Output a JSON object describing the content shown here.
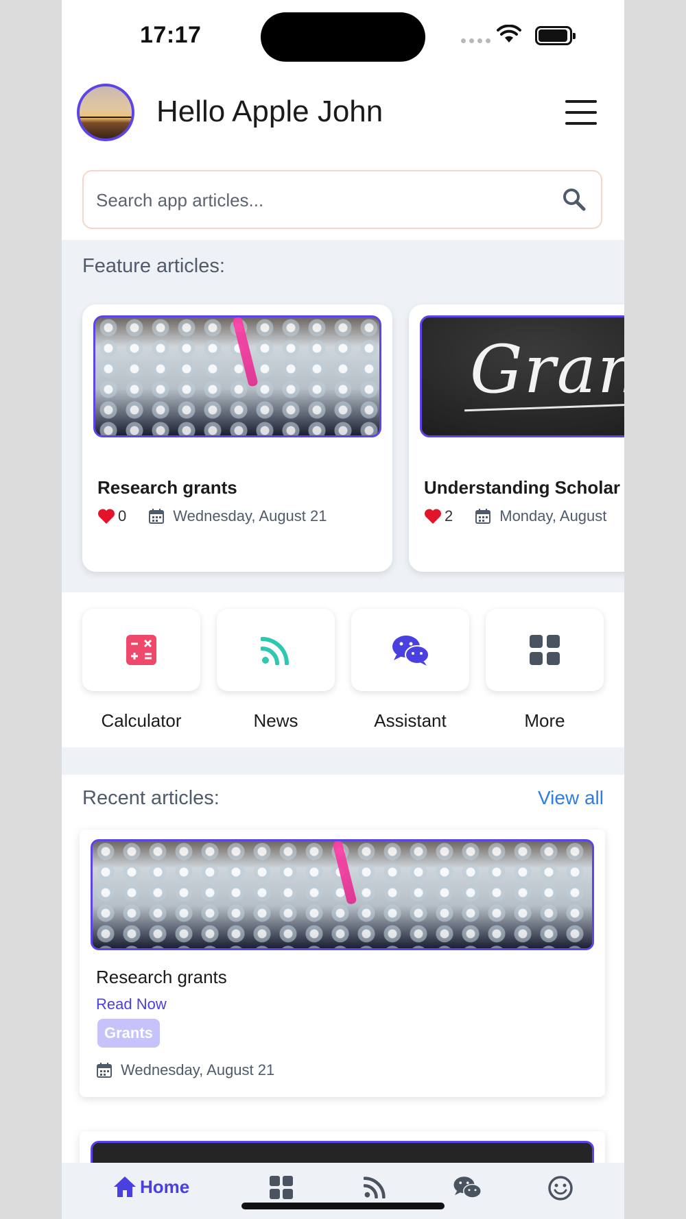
{
  "status_bar": {
    "time": "17:17"
  },
  "header": {
    "greeting": "Hello Apple John",
    "search": {
      "placeholder": "Search app articles..."
    }
  },
  "feature_section": {
    "title": "Feature articles:",
    "cards": [
      {
        "title": "Research grants",
        "likes": "0",
        "date": "Wednesday, August 21",
        "image": "lab-tubes"
      },
      {
        "title": "Understanding Scholar",
        "likes": "2",
        "date": "Monday, August",
        "image": "grant-chalkboard",
        "image_text": "Gran"
      }
    ]
  },
  "quick_actions": [
    {
      "label": "Calculator",
      "icon": "calculator-icon",
      "color": "#f0486b"
    },
    {
      "label": "News",
      "icon": "rss-icon",
      "color": "#2ec7b0"
    },
    {
      "label": "Assistant",
      "icon": "chat-icon",
      "color": "#4a3fe0"
    },
    {
      "label": "More",
      "icon": "grid-icon",
      "color": "#4a5360"
    }
  ],
  "recent_section": {
    "title": "Recent articles:",
    "view_all": "View all",
    "cards": [
      {
        "title": "Research grants",
        "cta": "Read Now",
        "tag": "Grants",
        "date": "Wednesday, August 21",
        "image": "lab-tubes"
      }
    ]
  },
  "bottom_nav": {
    "items": [
      {
        "label": "Home",
        "icon": "home-icon",
        "active": true
      },
      {
        "label": "",
        "icon": "grid-icon"
      },
      {
        "label": "",
        "icon": "rss-icon"
      },
      {
        "label": "",
        "icon": "chat-icon"
      },
      {
        "label": "",
        "icon": "smiley-icon"
      }
    ]
  },
  "colors": {
    "accent": "#4a3fe0",
    "link": "#2f7de1",
    "heart": "#e3132b"
  }
}
